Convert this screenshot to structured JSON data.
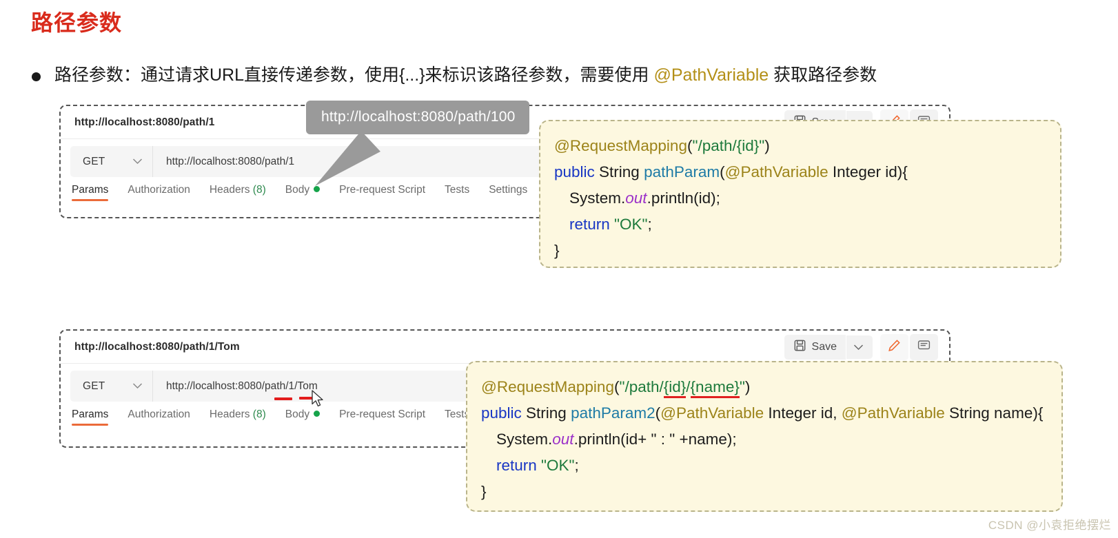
{
  "slide": {
    "title": "路径参数",
    "title_color": "#d92b1c",
    "bullet": {
      "prefix": "路径参数：通过请求URL直接传递参数，使用{...}来标识该路径参数，需要使用 ",
      "highlight": "@PathVariable",
      "suffix": " 获取路径参数",
      "highlight_color": "#b38f17"
    }
  },
  "callout": {
    "text": "http://localhost:8080/path/100",
    "bg_color": "#9a9a9a"
  },
  "panel1": {
    "tab_name": "http://localhost:8080/path/1",
    "save_label": "Save",
    "method": "GET",
    "url": "http://localhost:8080/path/1",
    "tabs": [
      {
        "label": "Params",
        "active": true
      },
      {
        "label": "Authorization",
        "active": false
      },
      {
        "label": "Headers",
        "count": "(8)",
        "active": false
      },
      {
        "label": "Body",
        "dot": true,
        "active": false
      },
      {
        "label": "Pre-request Script",
        "active": false
      },
      {
        "label": "Tests",
        "active": false
      },
      {
        "label": "Settings",
        "active": false
      }
    ]
  },
  "panel2": {
    "tab_name": "http://localhost:8080/path/1/Tom",
    "save_label": "Save",
    "method": "GET",
    "url": "http://localhost:8080/path/1/Tom",
    "tabs": [
      {
        "label": "Params",
        "active": true
      },
      {
        "label": "Authorization",
        "active": false
      },
      {
        "label": "Headers",
        "count": "(8)",
        "active": false
      },
      {
        "label": "Body",
        "dot": true,
        "active": false
      },
      {
        "label": "Pre-request Script",
        "active": false
      },
      {
        "label": "Tests",
        "active": false
      }
    ]
  },
  "code1": {
    "line1": {
      "annot": "@RequestMapping",
      "paren_open": "(",
      "string": "\"/path/{id}\"",
      "paren_close": ")"
    },
    "line2": {
      "kw": "public",
      "type": " String ",
      "method": "pathParam",
      "rest_open": "(",
      "annot": "@PathVariable",
      "rest": " Integer id){"
    },
    "line3": {
      "a": "System.",
      "static": "out",
      "b": ".println(id);"
    },
    "line4": {
      "kw": "return",
      "string": "\"OK\"",
      "end": ";"
    },
    "line5": "}"
  },
  "code2": {
    "line1": {
      "annot": "@RequestMapping",
      "paren_open": "(",
      "s1": "\"/path/",
      "u1": "{id}",
      "s2": "/",
      "u2": "{name}",
      "s3": "\"",
      "paren_close": ")"
    },
    "line2": {
      "kw": "public",
      "type": " String ",
      "method": "pathParam2",
      "rest_open": "(",
      "annot1": "@PathVariable",
      "mid": " Integer id, ",
      "annot2": "@PathVariable",
      "rest": " String name){"
    },
    "line3": {
      "a": "System.",
      "static": "out",
      "b": ".println(id+ \" : \" +name);"
    },
    "line4": {
      "kw": "return",
      "string": "\"OK\"",
      "end": ";"
    },
    "line5": "}"
  },
  "watermark": "CSDN @小袁拒绝摆烂",
  "colors": {
    "accent_orange": "#eb6b3a",
    "code_bg": "#fdf8e0",
    "annotation_gold": "#9c8319",
    "string_green": "#1d7a3c",
    "keyword_blue": "#1836c4",
    "method_teal": "#1e7ba6",
    "static_purple": "#9b30c9",
    "marker_red": "#e31d1d"
  }
}
